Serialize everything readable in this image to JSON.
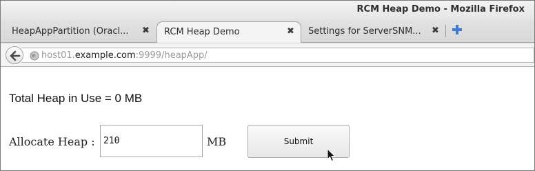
{
  "window": {
    "title": "RCM Heap Demo - Mozilla Firefox"
  },
  "tabs": [
    {
      "label": "HeapAppPartition (Oracl...",
      "close": "✖",
      "active": false
    },
    {
      "label": "RCM Heap Demo",
      "close": "✖",
      "active": true
    },
    {
      "label": "Settings for ServerSNM...",
      "close": "✖",
      "active": false
    }
  ],
  "new_tab_icon": "plus-icon",
  "navbar": {
    "back_icon": "back-arrow-icon",
    "site_icon": "globe-icon",
    "url_prefix": "host01.",
    "url_host": "example.com",
    "url_suffix": ":9999/heapApp/"
  },
  "page": {
    "heap_status": "Total Heap in Use = 0 MB",
    "allocate_label": "Allocate Heap :",
    "allocate_value": "210",
    "unit": "MB",
    "submit_label": "Submit"
  },
  "colors": {
    "new_tab_plus": "#3b7bd6",
    "url_dim": "#9a9a9a"
  }
}
